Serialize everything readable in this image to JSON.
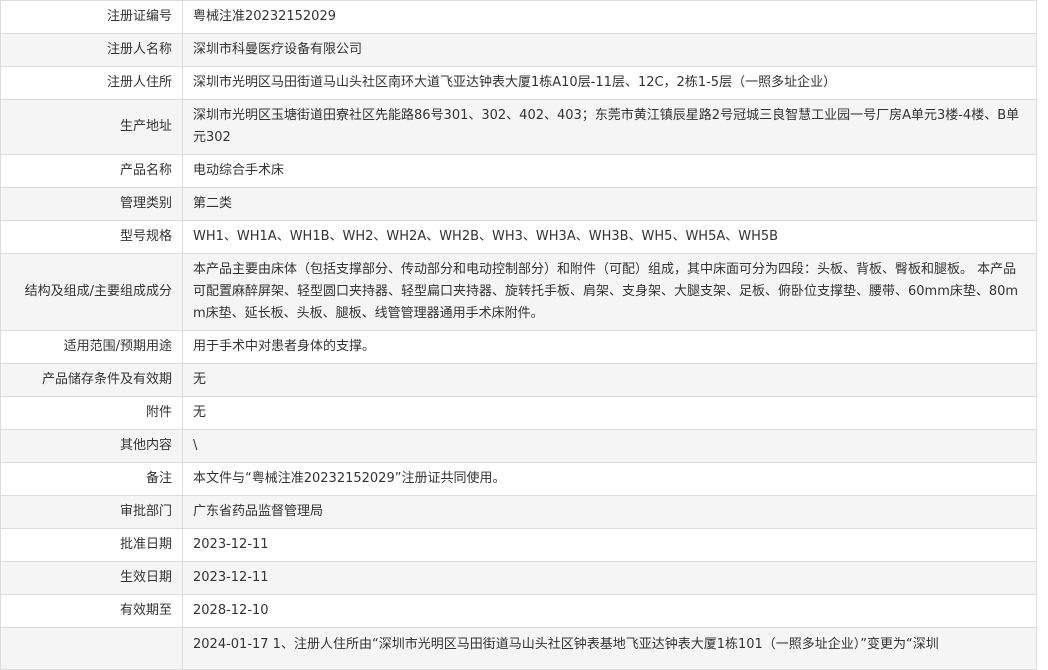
{
  "rows": [
    {
      "label": "注册证编号",
      "value": "粤械注准20232152029"
    },
    {
      "label": "注册人名称",
      "value": "深圳市科曼医疗设备有限公司"
    },
    {
      "label": "注册人住所",
      "value": "深圳市光明区马田街道马山头社区南环大道飞亚达钟表大厦1栋A10层-11层、12C，2栋1-5层（一照多址企业）"
    },
    {
      "label": "生产地址",
      "value": "深圳市光明区玉塘街道田寮社区先能路86号301、302、402、403；东莞市黄江镇辰星路2号冠城三良智慧工业园一号厂房A单元3楼-4楼、B单元302"
    },
    {
      "label": "产品名称",
      "value": "电动综合手术床"
    },
    {
      "label": "管理类别",
      "value": "第二类"
    },
    {
      "label": "型号规格",
      "value": "WH1、WH1A、WH1B、WH2、WH2A、WH2B、WH3、WH3A、WH3B、WH5、WH5A、WH5B"
    },
    {
      "label": "结构及组成/主要组成成分",
      "value": "本产品主要由床体（包括支撑部分、传动部分和电动控制部分）和附件（可配）组成，其中床面可分为四段：头板、背板、臀板和腿板。 本产品可配置麻醉屏架、轻型圆口夹持器、轻型扁口夹持器、旋转托手板、肩架、支身架、大腿支架、足板、俯卧位支撑垫、腰带、60mm床垫、80mm床垫、延长板、头板、腿板、线管管理器通用手术床附件。"
    },
    {
      "label": "适用范围/预期用途",
      "value": "用于手术中对患者身体的支撑。"
    },
    {
      "label": "产品储存条件及有效期",
      "value": "无"
    },
    {
      "label": "附件",
      "value": "无"
    },
    {
      "label": "其他内容",
      "value": "\\"
    },
    {
      "label": "备注",
      "value": "本文件与“粤械注准20232152029”注册证共同使用。"
    },
    {
      "label": "审批部门",
      "value": "广东省药品监督管理局"
    },
    {
      "label": "批准日期",
      "value": "2023-12-11"
    },
    {
      "label": "生效日期",
      "value": "2023-12-11"
    },
    {
      "label": "有效期至",
      "value": "2028-12-10"
    },
    {
      "label": "",
      "value": "2024-01-17 1、注册人住所由“深圳市光明区马田街道马山头社区钟表基地飞亚达钟表大厦1栋101（一照多址企业）”变更为“深圳"
    }
  ]
}
